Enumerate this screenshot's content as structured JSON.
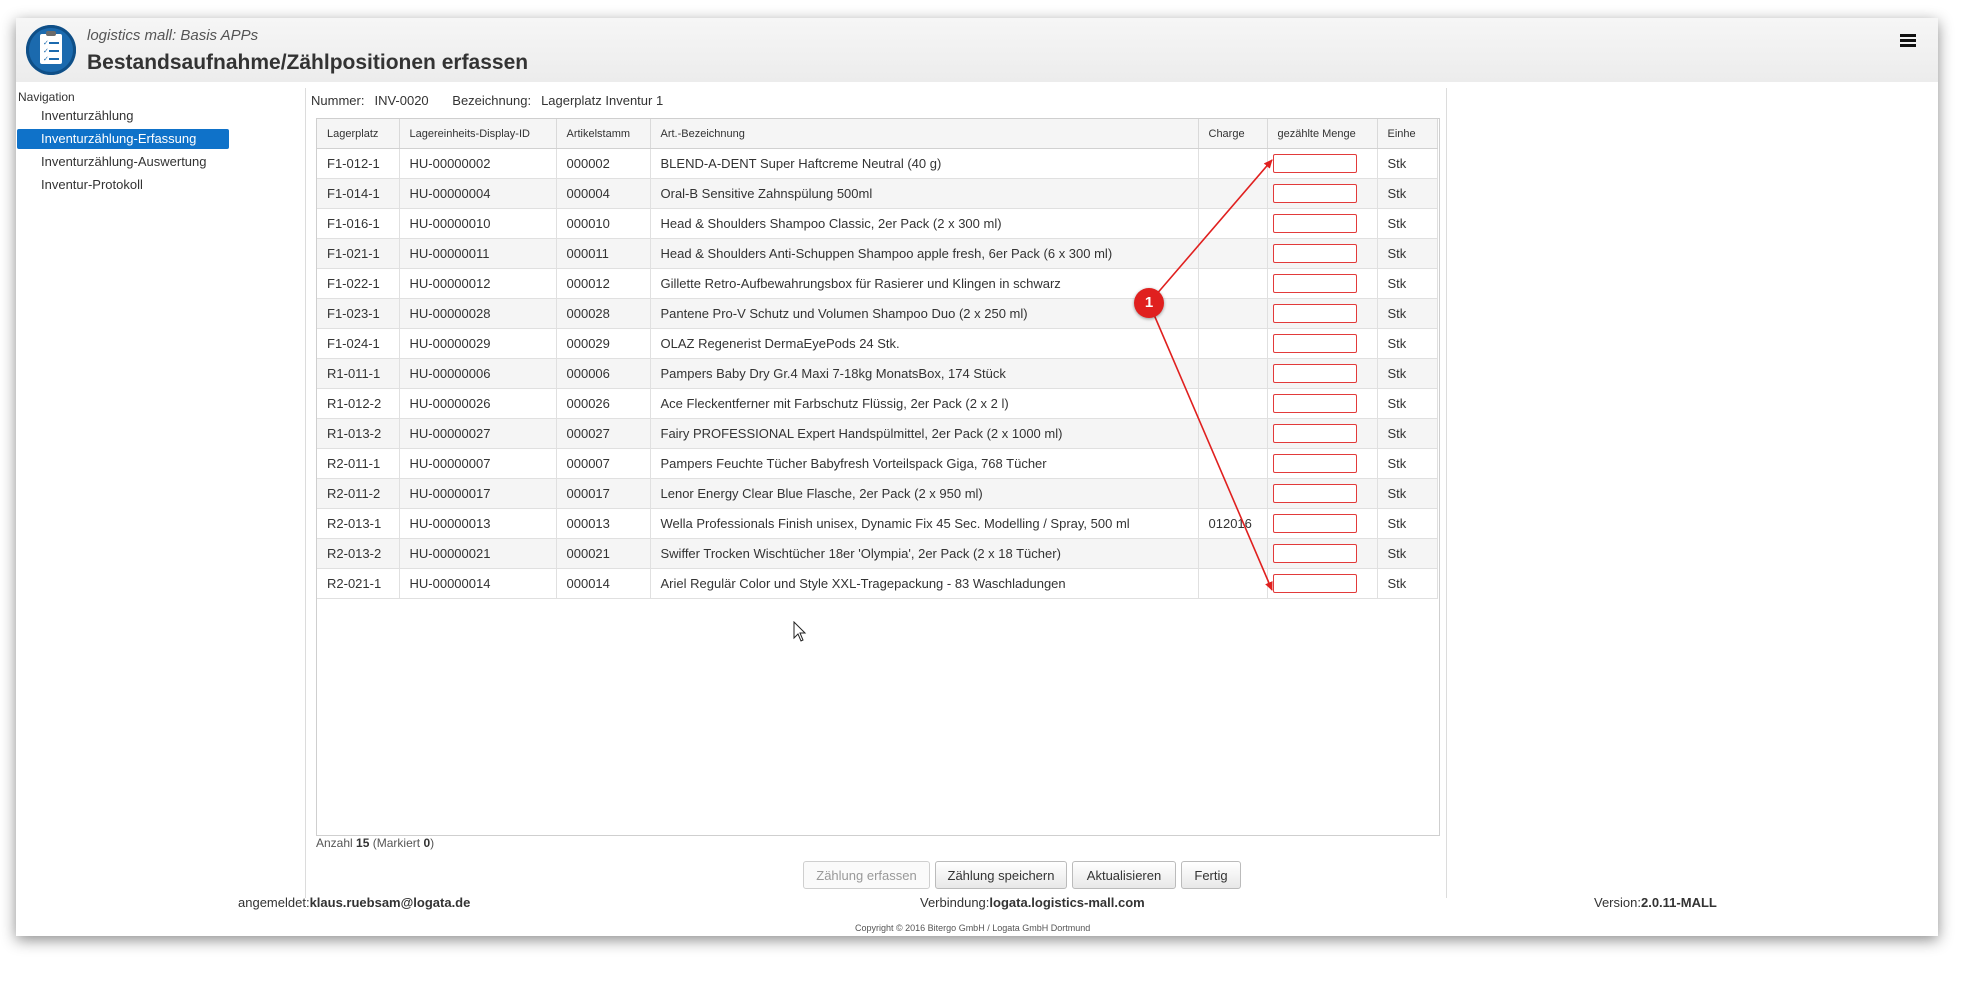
{
  "header": {
    "subtitle": "logistics mall: Basis APPs",
    "title": "Bestandsaufnahme/Zählpositionen erfassen",
    "menu_icon": "hamburger-menu-icon"
  },
  "nav": {
    "title": "Navigation",
    "items": [
      {
        "label": "Inventurzählung"
      },
      {
        "label": "Inventurzählung-Erfassung"
      },
      {
        "label": "Inventurzählung-Auswertung"
      },
      {
        "label": "Inventur-Protokoll"
      }
    ]
  },
  "meta": {
    "number_label": "Nummer:",
    "number_value": "INV-0020",
    "name_label": "Bezeichnung:",
    "name_value": "Lagerplatz Inventur 1"
  },
  "table": {
    "columns": [
      "Lagerplatz",
      "Lagereinheits-Display-ID",
      "Artikelstamm",
      "Art.-Bezeichnung",
      "Charge",
      "gezählte Menge",
      "Einhe"
    ],
    "rows": [
      {
        "lagerplatz": "F1-012-1",
        "display_id": "HU-00000002",
        "artikel": "000002",
        "bezeichnung": "BLEND-A-DENT Super Haftcreme Neutral (40 g)",
        "charge": "",
        "menge": "",
        "einheit": "Stk"
      },
      {
        "lagerplatz": "F1-014-1",
        "display_id": "HU-00000004",
        "artikel": "000004",
        "bezeichnung": "Oral-B Sensitive Zahnspülung 500ml",
        "charge": "",
        "menge": "",
        "einheit": "Stk"
      },
      {
        "lagerplatz": "F1-016-1",
        "display_id": "HU-00000010",
        "artikel": "000010",
        "bezeichnung": "Head & Shoulders Shampoo Classic, 2er Pack (2 x 300 ml)",
        "charge": "",
        "menge": "",
        "einheit": "Stk"
      },
      {
        "lagerplatz": "F1-021-1",
        "display_id": "HU-00000011",
        "artikel": "000011",
        "bezeichnung": "Head & Shoulders Anti-Schuppen Shampoo apple fresh, 6er Pack (6 x 300 ml)",
        "charge": "",
        "menge": "",
        "einheit": "Stk"
      },
      {
        "lagerplatz": "F1-022-1",
        "display_id": "HU-00000012",
        "artikel": "000012",
        "bezeichnung": "Gillette Retro-Aufbewahrungsbox für Rasierer und Klingen in schwarz",
        "charge": "",
        "menge": "",
        "einheit": "Stk"
      },
      {
        "lagerplatz": "F1-023-1",
        "display_id": "HU-00000028",
        "artikel": "000028",
        "bezeichnung": "Pantene Pro-V Schutz und Volumen Shampoo Duo (2 x 250 ml)",
        "charge": "",
        "menge": "",
        "einheit": "Stk"
      },
      {
        "lagerplatz": "F1-024-1",
        "display_id": "HU-00000029",
        "artikel": "000029",
        "bezeichnung": "OLAZ Regenerist DermaEyePods 24 Stk.",
        "charge": "",
        "menge": "",
        "einheit": "Stk"
      },
      {
        "lagerplatz": "R1-011-1",
        "display_id": "HU-00000006",
        "artikel": "000006",
        "bezeichnung": "Pampers Baby Dry Gr.4 Maxi 7-18kg MonatsBox, 174 Stück",
        "charge": "",
        "menge": "",
        "einheit": "Stk"
      },
      {
        "lagerplatz": "R1-012-2",
        "display_id": "HU-00000026",
        "artikel": "000026",
        "bezeichnung": "Ace Fleckentferner mit Farbschutz Flüssig, 2er Pack (2 x 2 l)",
        "charge": "",
        "menge": "",
        "einheit": "Stk"
      },
      {
        "lagerplatz": "R1-013-2",
        "display_id": "HU-00000027",
        "artikel": "000027",
        "bezeichnung": "Fairy PROFESSIONAL Expert Handspülmittel, 2er Pack (2 x 1000 ml)",
        "charge": "",
        "menge": "",
        "einheit": "Stk"
      },
      {
        "lagerplatz": "R2-011-1",
        "display_id": "HU-00000007",
        "artikel": "000007",
        "bezeichnung": "Pampers Feuchte Tücher Babyfresh Vorteilspack Giga, 768 Tücher",
        "charge": "",
        "menge": "",
        "einheit": "Stk"
      },
      {
        "lagerplatz": "R2-011-2",
        "display_id": "HU-00000017",
        "artikel": "000017",
        "bezeichnung": "Lenor Energy Clear Blue Flasche, 2er Pack (2 x 950 ml)",
        "charge": "",
        "menge": "",
        "einheit": "Stk"
      },
      {
        "lagerplatz": "R2-013-1",
        "display_id": "HU-00000013",
        "artikel": "000013",
        "bezeichnung": "Wella Professionals Finish unisex, Dynamic Fix 45 Sec. Modelling / Spray, 500 ml",
        "charge": "012016",
        "menge": "",
        "einheit": "Stk"
      },
      {
        "lagerplatz": "R2-013-2",
        "display_id": "HU-00000021",
        "artikel": "000021",
        "bezeichnung": "Swiffer Trocken Wischtücher 18er 'Olympia', 2er Pack (2 x 18 Tücher)",
        "charge": "",
        "menge": "",
        "einheit": "Stk"
      },
      {
        "lagerplatz": "R2-021-1",
        "display_id": "HU-00000014",
        "artikel": "000014",
        "bezeichnung": "Ariel Regulär Color und Style XXL-Tragepackung - 83 Waschladungen",
        "charge": "",
        "menge": "",
        "einheit": "Stk"
      }
    ]
  },
  "count": {
    "label": "Anzahl",
    "value": "15",
    "marked_label": "(Markiert",
    "marked_value": "0",
    "marked_close": ")"
  },
  "buttons": {
    "erfassen": "Zählung erfassen",
    "speichern": "Zählung speichern",
    "aktualisieren": "Aktualisieren",
    "fertig": "Fertig"
  },
  "footer": {
    "user_label": "angemeldet:",
    "user_value": "klaus.ruebsam@logata.de",
    "conn_label": "Verbindung:",
    "conn_value": "logata.logistics-mall.com",
    "version_label": "Version:",
    "version_value": "2.0.11-MALL",
    "copyright": "Copyright © 2016 Bitergo GmbH / Logata GmbH Dortmund"
  },
  "annotation": {
    "badge": "1",
    "color": "#e0201f"
  },
  "colors": {
    "accent": "#0f72c9",
    "input_border": "#e23a3a"
  }
}
